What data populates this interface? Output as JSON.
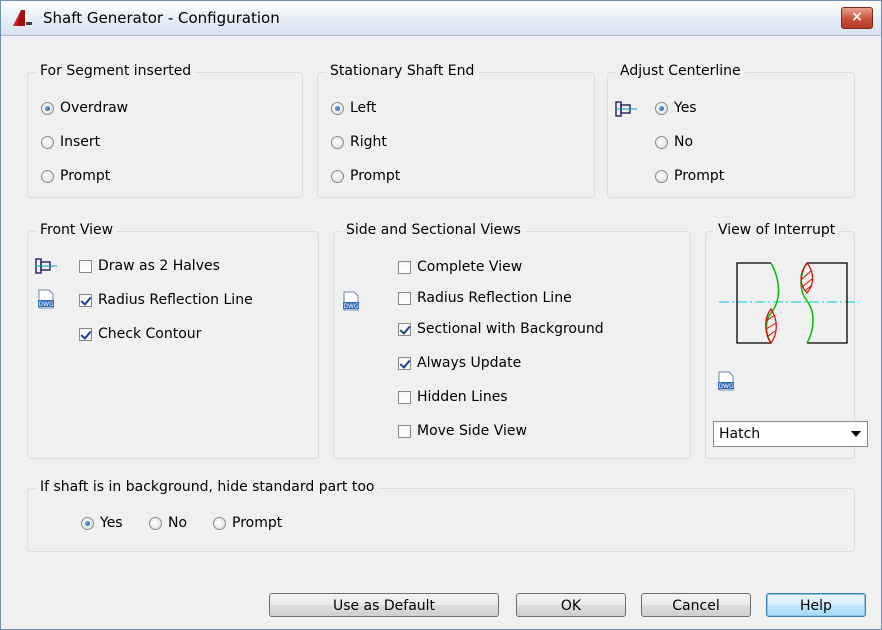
{
  "window": {
    "title": "Shaft Generator - Configuration",
    "close_label": "×"
  },
  "segment_inserted": {
    "title": "For Segment inserted",
    "options": [
      "Overdraw",
      "Insert",
      "Prompt"
    ],
    "selected": "Overdraw"
  },
  "stationary_end": {
    "title": "Stationary Shaft End",
    "options": [
      "Left",
      "Right",
      "Prompt"
    ],
    "selected": "Left"
  },
  "adjust_centerline": {
    "title": "Adjust Centerline",
    "options": [
      "Yes",
      "No",
      "Prompt"
    ],
    "selected": "Yes",
    "icon": "shaft-icon"
  },
  "front_view": {
    "title": "Front View",
    "items": [
      {
        "label": "Draw as 2 Halves",
        "checked": false,
        "icon": "shaft-icon"
      },
      {
        "label": "Radius Reflection Line",
        "checked": true,
        "icon": "dwg-icon"
      },
      {
        "label": "Check Contour",
        "checked": true
      }
    ]
  },
  "side_sectional": {
    "title": "Side and Sectional Views",
    "icon": "dwg-icon",
    "items": [
      {
        "label": "Complete View",
        "checked": false
      },
      {
        "label": "Radius Reflection Line",
        "checked": false
      },
      {
        "label": "Sectional with Background",
        "checked": true
      },
      {
        "label": "Always Update",
        "checked": true
      },
      {
        "label": "Hidden Lines",
        "checked": false
      },
      {
        "label": "Move Side View",
        "checked": false
      }
    ]
  },
  "view_interrupt": {
    "title": "View of Interrupt",
    "icon": "dwg-icon",
    "select_value": "Hatch",
    "colors": {
      "centerline": "#00c8e6",
      "hatch": "#e00000",
      "contour": "#00c000"
    }
  },
  "hide_standard": {
    "title": "If shaft is in background, hide standard part too",
    "options": [
      "Yes",
      "No",
      "Prompt"
    ],
    "selected": "Yes"
  },
  "buttons": {
    "use_default": "Use as Default",
    "ok": "OK",
    "cancel": "Cancel",
    "help": "Help"
  }
}
